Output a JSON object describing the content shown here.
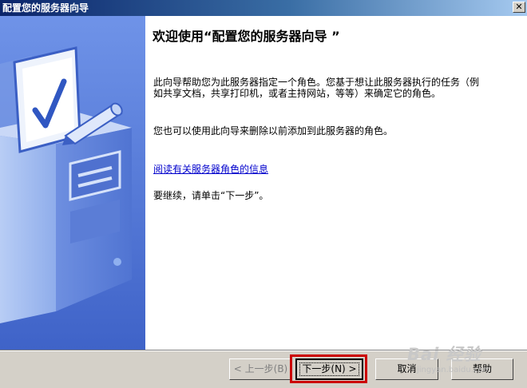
{
  "window": {
    "title": "配置您的服务器向导",
    "close_glyph": "✕"
  },
  "content": {
    "heading": "欢迎使用“配置您的服务器向导 ”",
    "paragraph1": "此向导帮助您为此服务器指定一个角色。您基于想让此服务器执行的任务（例如共享文档，共享打印机，或者主持网站，等等）来确定它的角色。",
    "paragraph2": "您也可以使用此向导来删除以前添加到此服务器的角色。",
    "link": "阅读有关服务器角色的信息",
    "paragraph3": "要继续，请单击“下一步”。"
  },
  "buttons": {
    "back": "< 上一步(B)",
    "next": "下一步(N) >",
    "cancel": "取消",
    "help": "帮助"
  },
  "watermark": {
    "logo": "Bai 经验",
    "url": "jingyan.baidu.com"
  },
  "colors": {
    "side_panel": "#5a7edc",
    "highlight": "#cc0000",
    "link": "#0000cc"
  },
  "icons": {
    "side_graphic": "server-checklist-illustration",
    "close": "close-icon"
  }
}
